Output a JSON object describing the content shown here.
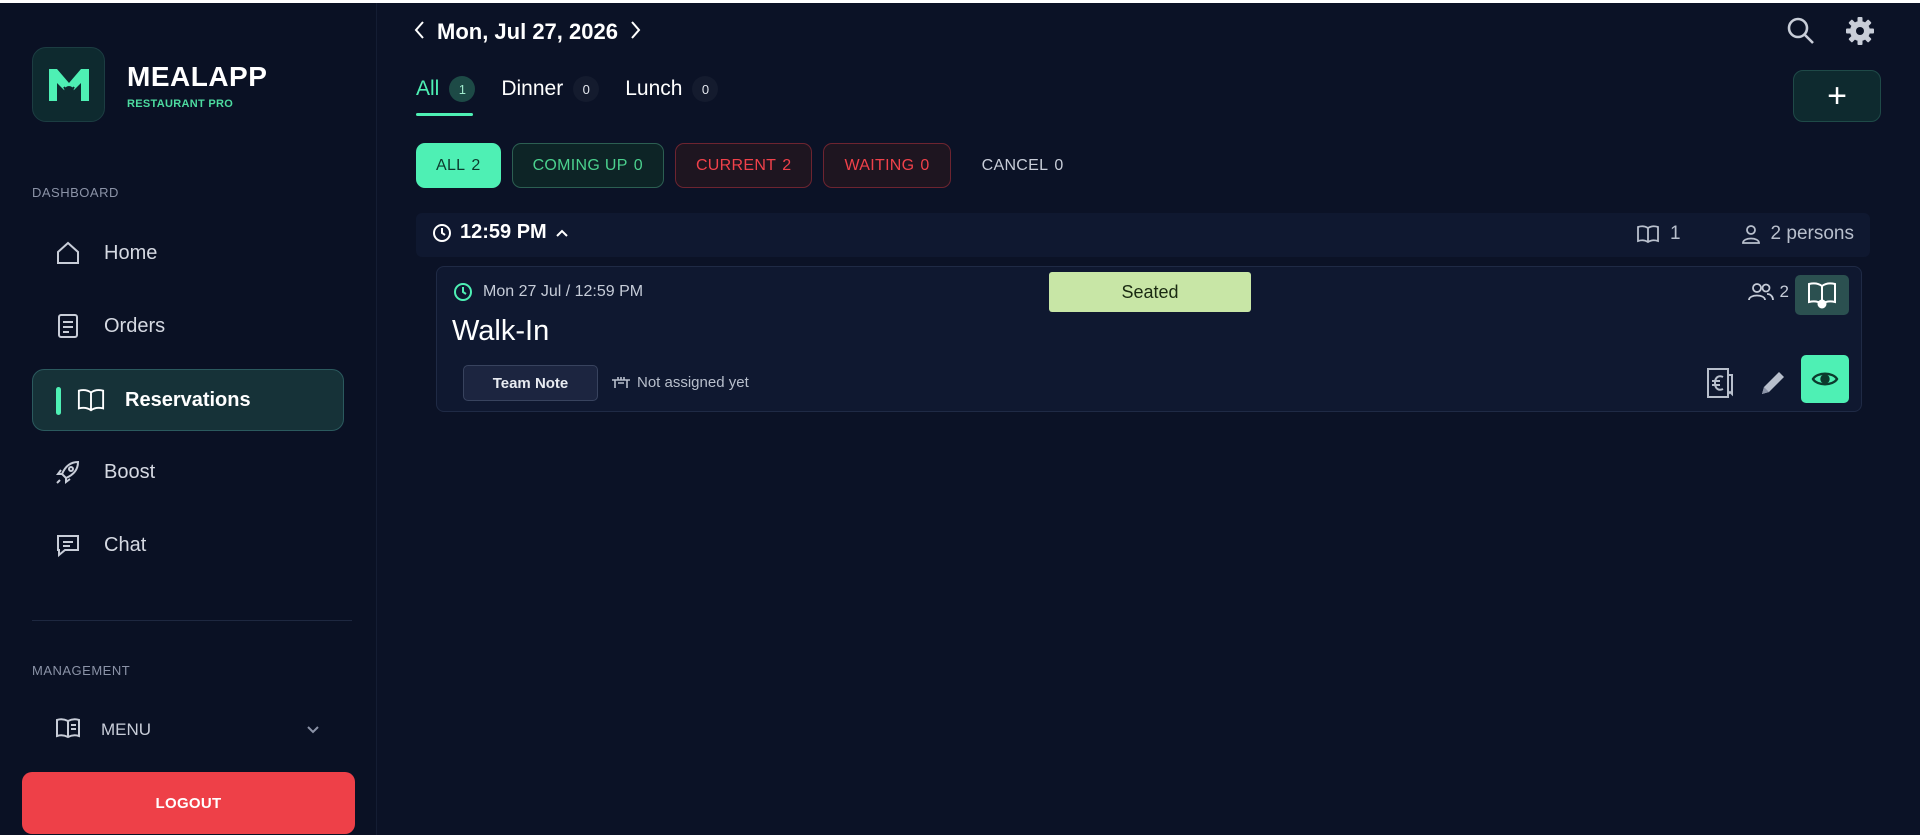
{
  "app": {
    "brand": "MEALAPP",
    "brand_sub": "RESTAURANT PRO",
    "colors": {
      "accent": "#4ef0b4",
      "danger": "#ee4048",
      "background": "#0b1226"
    }
  },
  "sidebar": {
    "dashboard_label": "DASHBOARD",
    "items": [
      {
        "label": "Home",
        "icon": "home-icon"
      },
      {
        "label": "Orders",
        "icon": "orders-icon"
      },
      {
        "label": "Reservations",
        "icon": "book-icon"
      },
      {
        "label": "Boost",
        "icon": "rocket-icon"
      },
      {
        "label": "Chat",
        "icon": "chat-icon"
      }
    ],
    "management_label": "MANAGEMENT",
    "menu_label": "MENU",
    "logout_label": "LOGOUT"
  },
  "header": {
    "date": "Mon, Jul 27, 2026",
    "tabs": [
      {
        "label": "All",
        "count": "1"
      },
      {
        "label": "Dinner",
        "count": "0"
      },
      {
        "label": "Lunch",
        "count": "0"
      }
    ],
    "add_label": "+"
  },
  "filters": [
    {
      "label": "ALL",
      "count": "2"
    },
    {
      "label": "COMING UP",
      "count": "0"
    },
    {
      "label": "CURRENT",
      "count": "2"
    },
    {
      "label": "WAITING",
      "count": "0"
    },
    {
      "label": "CANCEL",
      "count": "0"
    }
  ],
  "group": {
    "time": "12:59 PM",
    "bookings": "1",
    "persons": "2 persons"
  },
  "reservation": {
    "datetime": "Mon 27 Jul / 12:59 PM",
    "title": "Walk-In",
    "status": "Seated",
    "party_size": "2",
    "team_note_label": "Team Note",
    "table_status": "Not assigned yet"
  }
}
